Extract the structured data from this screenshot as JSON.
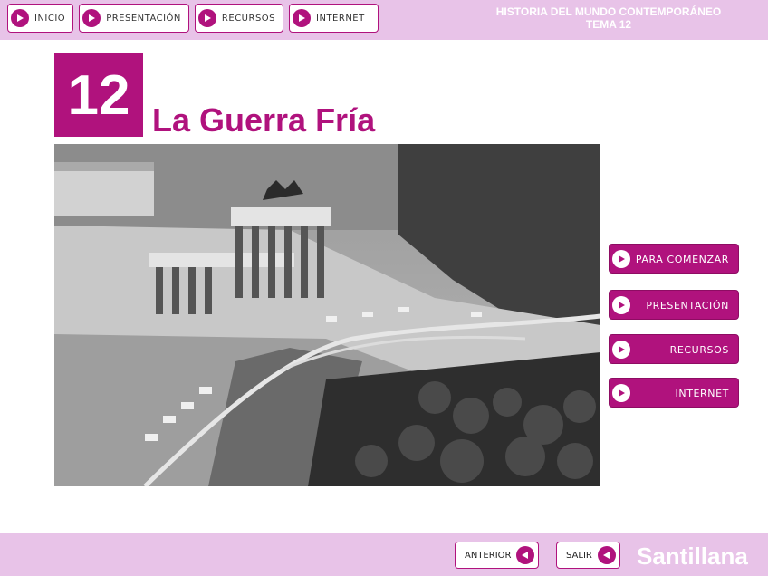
{
  "header": {
    "nav": [
      {
        "label": "INICIO"
      },
      {
        "label": "PRESENTACIÓN"
      },
      {
        "label": "RECURSOS"
      },
      {
        "label": "INTERNET"
      }
    ],
    "course_title": "HISTORIA DEL MUNDO CONTEMPORÁNEO",
    "unit": "TEMA 12"
  },
  "main": {
    "number": "12",
    "title": "La Guerra Fría",
    "menu": [
      {
        "label": "PARA COMENZAR"
      },
      {
        "label": "PRESENTACIÓN"
      },
      {
        "label": "RECURSOS"
      },
      {
        "label": "INTERNET"
      }
    ]
  },
  "footer": {
    "prev_label": "ANTERIOR",
    "exit_label": "SALIR",
    "brand": "Santillana"
  },
  "colors": {
    "accent": "#b0127d",
    "bar": "#e8c3e8"
  },
  "icons": {
    "forward": "play-right-icon",
    "back": "play-left-icon"
  }
}
